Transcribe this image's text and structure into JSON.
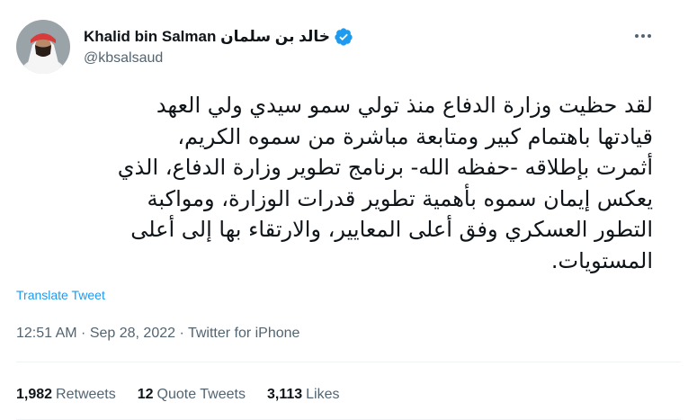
{
  "author": {
    "name": "Khalid bin Salman خالد بن سلمان",
    "handle": "@kbsalsaud",
    "verified": true
  },
  "tweet": {
    "lines": [
      "لقد حظيت وزارة الدفاع منذ تولي سمو سيدي ولي العهد",
      "قيادتها باهتمام كبير ومتابعة مباشرة من سموه الكريم،",
      "أثمرت بإطلاقه -حفظه الله- برنامج تطوير وزارة الدفاع، الذي",
      "يعكس إيمان سموه بأهمية تطوير قدرات الوزارة، ومواكبة",
      "التطور العسكري وفق أعلى المعايير، والارتقاء بها إلى أعلى",
      "المستويات."
    ],
    "translate_label": "Translate Tweet"
  },
  "meta": {
    "time": "12:51 AM",
    "date": "Sep 28, 2022",
    "source": "Twitter for iPhone",
    "full": "12:51 AM · Sep 28, 2022 · Twitter for iPhone"
  },
  "stats": {
    "retweets": {
      "count": "1,982",
      "label": "Retweets"
    },
    "quotes": {
      "count": "12",
      "label": "Quote Tweets"
    },
    "likes": {
      "count": "3,113",
      "label": "Likes"
    }
  },
  "colors": {
    "accent": "#1d9bf0",
    "secondary_text": "#536471",
    "primary_text": "#0f1419"
  },
  "icons": {
    "verified": "verified-badge-icon",
    "more": "more-options-icon"
  }
}
